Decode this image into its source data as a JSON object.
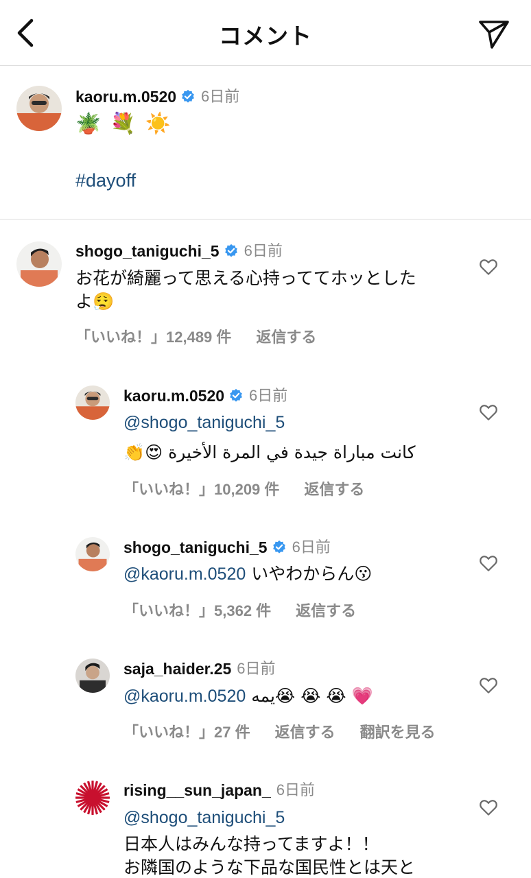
{
  "header": {
    "title": "コメント",
    "back_icon": "chevron-left-icon",
    "send_icon": "send-icon"
  },
  "caption": {
    "username": "kaoru.m.0520",
    "verified": true,
    "time": "6日前",
    "emojis": "🪴 💐 ☀️",
    "hashtag": "#dayoff"
  },
  "comments": [
    {
      "username": "shogo_taniguchi_5",
      "verified": true,
      "time": "6日前",
      "text": "お花が綺麗って思える心持っててホッとした",
      "text2": "よ😮‍💨",
      "likes": "「いいね！」12,489 件",
      "reply": "返信する"
    },
    {
      "username": "kaoru.m.0520",
      "verified": true,
      "time": "6日前",
      "mention": "@shogo_taniguchi_5",
      "text": "كانت مباراة جيدة في المرة الأخيرة 😍👏",
      "likes": "「いいね！」10,209 件",
      "reply": "返信する"
    },
    {
      "username": "shogo_taniguchi_5",
      "verified": true,
      "time": "6日前",
      "mention": "@kaoru.m.0520",
      "text": " いやわからん😗",
      "likes": "「いいね！」5,362 件",
      "reply": "返信する"
    },
    {
      "username": "saja_haider.25",
      "verified": false,
      "time": "6日前",
      "mention": "@kaoru.m.0520",
      "text": " يمه😭 😭 😭 💗",
      "likes": "「いいね！」27 件",
      "reply": "返信する",
      "translate": "翻訳を見る"
    },
    {
      "username": "rising__sun_japan_",
      "verified": false,
      "time": "6日前",
      "mention": "@shogo_taniguchi_5",
      "text": "日本人はみんな持ってますよ！！",
      "text2": "お隣国のような下品な国民性とは天と"
    }
  ],
  "colors": {
    "link": "#1e4e79",
    "muted": "#8a8a8a",
    "verified": "#3897f0"
  }
}
